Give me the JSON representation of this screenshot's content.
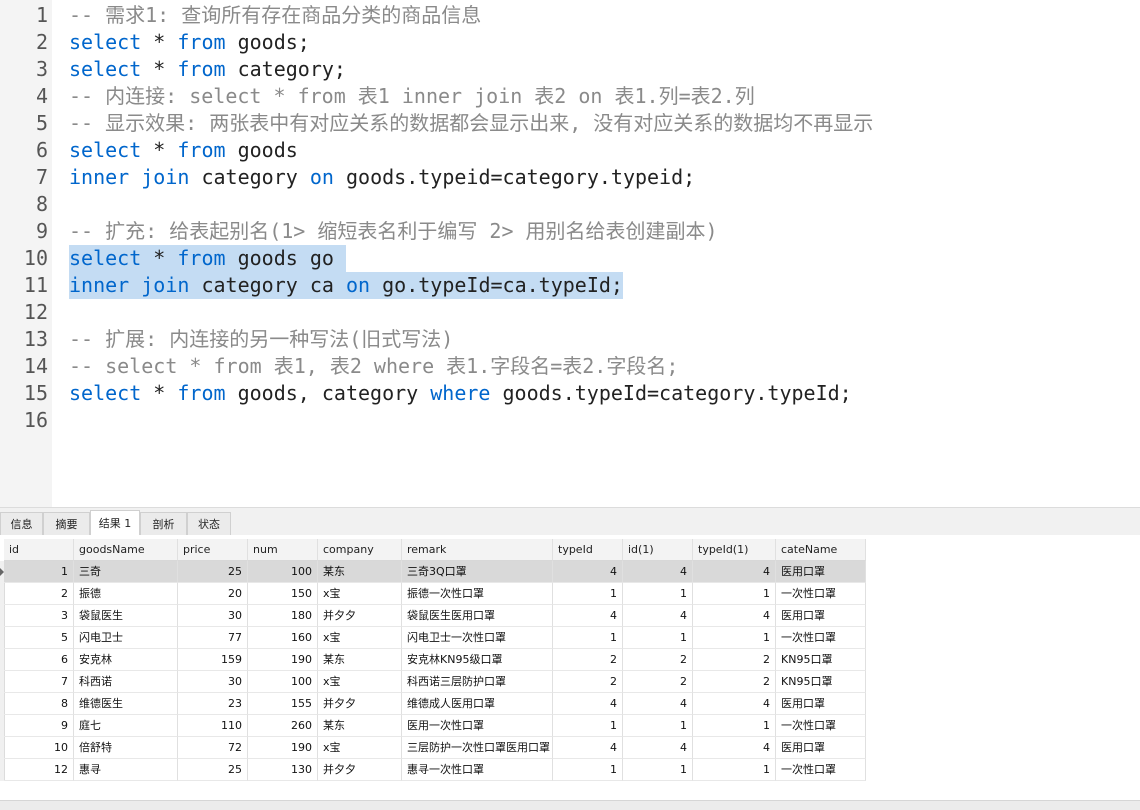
{
  "editor": {
    "lines": [
      {
        "num": "1",
        "tokens": [
          {
            "t": "-- 需求1: 查询所有存在商品分类的商品信息",
            "c": "cm"
          }
        ]
      },
      {
        "num": "2",
        "tokens": [
          {
            "t": "select",
            "c": "kw"
          },
          {
            "t": " * ",
            "c": "tx"
          },
          {
            "t": "from",
            "c": "kw"
          },
          {
            "t": " goods;",
            "c": "tx"
          }
        ]
      },
      {
        "num": "3",
        "tokens": [
          {
            "t": "select",
            "c": "kw"
          },
          {
            "t": " * ",
            "c": "tx"
          },
          {
            "t": "from",
            "c": "kw"
          },
          {
            "t": " category;",
            "c": "tx"
          }
        ]
      },
      {
        "num": "4",
        "tokens": [
          {
            "t": "-- 内连接: select * from 表1 inner join 表2 on 表1.列=表2.列",
            "c": "cm"
          }
        ]
      },
      {
        "num": "5",
        "tokens": [
          {
            "t": "-- 显示效果: 两张表中有对应关系的数据都会显示出来, 没有对应关系的数据均不再显示",
            "c": "cm"
          }
        ]
      },
      {
        "num": "6",
        "tokens": [
          {
            "t": "select",
            "c": "kw"
          },
          {
            "t": " * ",
            "c": "tx"
          },
          {
            "t": "from",
            "c": "kw"
          },
          {
            "t": " goods",
            "c": "tx"
          }
        ]
      },
      {
        "num": "7",
        "tokens": [
          {
            "t": "inner",
            "c": "kw"
          },
          {
            "t": " ",
            "c": "tx"
          },
          {
            "t": "join",
            "c": "kw"
          },
          {
            "t": " category ",
            "c": "tx"
          },
          {
            "t": "on",
            "c": "kw"
          },
          {
            "t": " goods.typeid=category.typeid;",
            "c": "tx"
          }
        ]
      },
      {
        "num": "8",
        "tokens": []
      },
      {
        "num": "9",
        "tokens": [
          {
            "t": "-- 扩充: 给表起别名(1> 缩短表名利于编写 2> 用别名给表创建副本)",
            "c": "cm"
          }
        ]
      },
      {
        "num": "10",
        "highlight": true,
        "tokens": [
          {
            "t": "select",
            "c": "kw"
          },
          {
            "t": " * ",
            "c": "tx"
          },
          {
            "t": "from",
            "c": "kw"
          },
          {
            "t": " goods go ",
            "c": "tx"
          }
        ]
      },
      {
        "num": "11",
        "highlight": true,
        "tokens": [
          {
            "t": "inner",
            "c": "kw"
          },
          {
            "t": " ",
            "c": "tx"
          },
          {
            "t": "join",
            "c": "kw"
          },
          {
            "t": " category ca ",
            "c": "tx"
          },
          {
            "t": "on",
            "c": "kw"
          },
          {
            "t": " go.typeId=ca.typeId;",
            "c": "tx"
          }
        ]
      },
      {
        "num": "12",
        "tokens": []
      },
      {
        "num": "13",
        "tokens": [
          {
            "t": "-- 扩展: 内连接的另一种写法(旧式写法)",
            "c": "cm"
          }
        ]
      },
      {
        "num": "14",
        "tokens": [
          {
            "t": "-- select * from 表1, 表2 where 表1.字段名=表2.字段名;",
            "c": "cm"
          }
        ]
      },
      {
        "num": "15",
        "tokens": [
          {
            "t": "select",
            "c": "kw"
          },
          {
            "t": " * ",
            "c": "tx"
          },
          {
            "t": "from",
            "c": "kw"
          },
          {
            "t": " goods, category ",
            "c": "tx"
          },
          {
            "t": "where",
            "c": "kw"
          },
          {
            "t": " goods.typeId=category.typeId;",
            "c": "tx"
          }
        ]
      },
      {
        "num": "16",
        "tokens": []
      }
    ]
  },
  "tabs": [
    {
      "label": "信息",
      "active": false
    },
    {
      "label": "摘要",
      "active": false
    },
    {
      "label": "结果 1",
      "active": true
    },
    {
      "label": "剖析",
      "active": false
    },
    {
      "label": "状态",
      "active": false
    }
  ],
  "grid": {
    "columns": [
      "id",
      "goodsName",
      "price",
      "num",
      "company",
      "remark",
      "typeId",
      "id(1)",
      "typeId(1)",
      "cateName"
    ],
    "numeric": [
      true,
      false,
      true,
      true,
      false,
      false,
      true,
      true,
      true,
      false
    ],
    "selected_row": 0,
    "rows": [
      [
        "1",
        "三奇",
        "25",
        "100",
        "某东",
        "三奇3Q口罩",
        "4",
        "4",
        "4",
        "医用口罩"
      ],
      [
        "2",
        "振德",
        "20",
        "150",
        "x宝",
        "振德一次性口罩",
        "1",
        "1",
        "1",
        "一次性口罩"
      ],
      [
        "3",
        "袋鼠医生",
        "30",
        "180",
        "并夕夕",
        "袋鼠医生医用口罩",
        "4",
        "4",
        "4",
        "医用口罩"
      ],
      [
        "5",
        "闪电卫士",
        "77",
        "160",
        "x宝",
        "闪电卫士一次性口罩",
        "1",
        "1",
        "1",
        "一次性口罩"
      ],
      [
        "6",
        "安克林",
        "159",
        "190",
        "某东",
        "安克林KN95级口罩",
        "2",
        "2",
        "2",
        "KN95口罩"
      ],
      [
        "7",
        "科西诺",
        "30",
        "100",
        "x宝",
        "科西诺三层防护口罩",
        "2",
        "2",
        "2",
        "KN95口罩"
      ],
      [
        "8",
        "维德医生",
        "23",
        "155",
        "并夕夕",
        "维德成人医用口罩",
        "4",
        "4",
        "4",
        "医用口罩"
      ],
      [
        "9",
        "庭七",
        "110",
        "260",
        "某东",
        "医用一次性口罩",
        "1",
        "1",
        "1",
        "一次性口罩"
      ],
      [
        "10",
        "倍舒特",
        "72",
        "190",
        "x宝",
        "三层防护一次性口罩医用口罩",
        "4",
        "4",
        "4",
        "医用口罩"
      ],
      [
        "12",
        "惠寻",
        "25",
        "130",
        "并夕夕",
        "惠寻一次性口罩",
        "1",
        "1",
        "1",
        "一次性口罩"
      ]
    ]
  }
}
